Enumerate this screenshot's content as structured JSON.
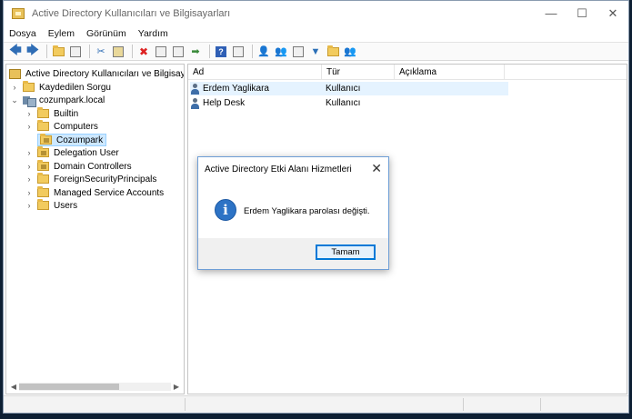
{
  "window": {
    "title": "Active Directory Kullanıcıları ve Bilgisayarları",
    "controls": {
      "minimize": "—",
      "maximize": "☐",
      "close": "✕"
    }
  },
  "menu": [
    "Dosya",
    "Eylem",
    "Görünüm",
    "Yardım"
  ],
  "toolbar": {
    "icons": [
      "back-icon",
      "forward-icon",
      "up-folder-icon",
      "console-tree-icon",
      "cut-icon",
      "paste-icon",
      "delete-icon",
      "properties-icon",
      "refresh-icon",
      "export-icon",
      "help-icon",
      "show-pane-icon",
      "add-user-icon",
      "add-group-icon",
      "add-ou-icon",
      "filter-icon",
      "find-icon",
      "add-to-group-icon"
    ]
  },
  "tree": {
    "root": "Active Directory Kullanıcıları ve Bilgisayarları",
    "items": [
      {
        "label": "Kaydedilen Sorgu",
        "level": 1,
        "expander": "›"
      },
      {
        "label": "cozumpark.local",
        "level": 1,
        "expander": "⌄"
      },
      {
        "label": "Builtin",
        "level": 2,
        "expander": "›"
      },
      {
        "label": "Computers",
        "level": 2,
        "expander": "›"
      },
      {
        "label": "Cozumpark",
        "level": 2,
        "expander": ""
      },
      {
        "label": "Delegation User",
        "level": 2,
        "expander": "›"
      },
      {
        "label": "Domain Controllers",
        "level": 2,
        "expander": "›"
      },
      {
        "label": "ForeignSecurityPrincipals",
        "level": 2,
        "expander": "›"
      },
      {
        "label": "Managed Service Accounts",
        "level": 2,
        "expander": "›"
      },
      {
        "label": "Users",
        "level": 2,
        "expander": "›"
      }
    ],
    "selected": "Cozumpark"
  },
  "list": {
    "columns": [
      "Ad",
      "Tür",
      "Açıklama"
    ],
    "rows": [
      {
        "name": "Erdem Yaglikara",
        "type": "Kullanıcı",
        "description": ""
      },
      {
        "name": "Help Desk",
        "type": "Kullanıcı",
        "description": ""
      }
    ]
  },
  "dialog": {
    "title": "Active Directory Etki Alanı Hizmetleri",
    "message": "Erdem Yaglikara parolası değişti.",
    "ok_label": "Tamam",
    "close": "✕",
    "info_glyph": "i"
  },
  "colors": {
    "accent": "#0078d7",
    "selection": "#cde8ff",
    "info": "#2d73c5"
  }
}
